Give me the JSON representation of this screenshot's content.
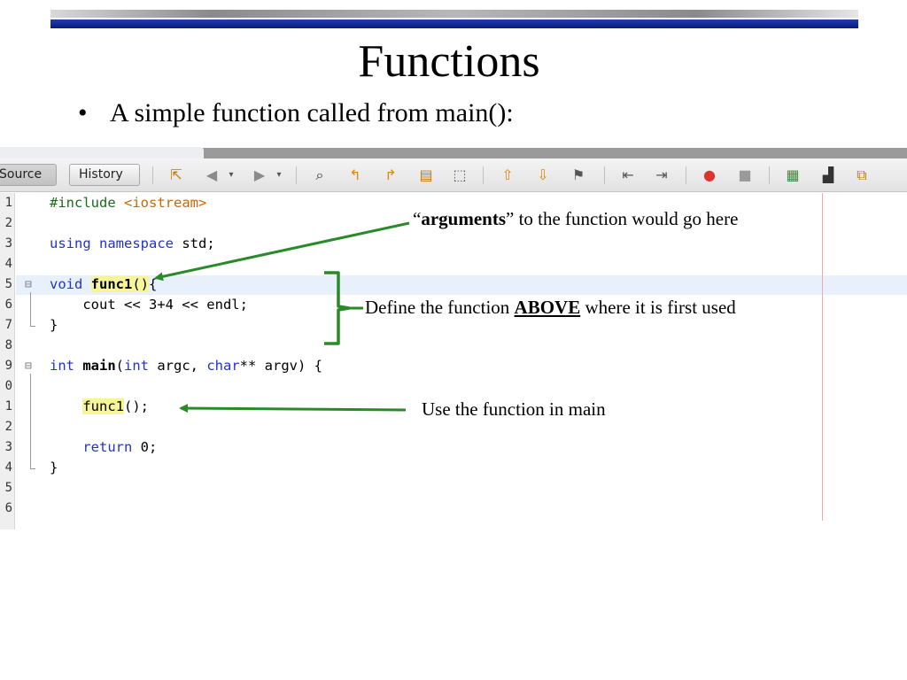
{
  "slide": {
    "title": "Functions",
    "bullet_symbol": "•",
    "bullet_text": "A simple function called from main():"
  },
  "toolbar": {
    "source_label": "Source",
    "history_label": "History",
    "icons": [
      "last-edit-icon",
      "back-icon",
      "forward-icon",
      "find-icon",
      "find-previous-icon",
      "find-next-icon",
      "toggle-highlight-icon",
      "toggle-rect-selection-icon",
      "previous-bookmark-icon",
      "next-bookmark-icon",
      "toggle-bookmark-icon",
      "shift-left-icon",
      "shift-right-icon",
      "start-macro-icon",
      "stop-macro-icon",
      "diff-icon",
      "format-icon",
      "debug-icon"
    ]
  },
  "editor": {
    "line_numbers": [
      "1",
      "2",
      "3",
      "4",
      "5",
      "6",
      "7",
      "8",
      "9",
      "0",
      "1",
      "2",
      "3",
      "4",
      "5",
      "6"
    ],
    "fold_markers": [
      "⊟",
      "⊟"
    ]
  },
  "code": {
    "l1_directive": "#include ",
    "l1_header": "<iostream>",
    "l3_using": "using",
    "l3_namespace": "namespace",
    "l3_rest": " std;",
    "l5_void": "void",
    "l5_name": "func1",
    "l5_parens": "()",
    "l5_brace": "{",
    "l6_body": "    cout << 3+4 << endl;",
    "l7_close": "}",
    "l9_int": "int",
    "l9_main": "main",
    "l9_open": "(",
    "l9_int2": "int",
    "l9_argc": " argc, ",
    "l9_char": "char",
    "l9_rest": "** argv) {",
    "l11_call": "func1",
    "l11_rest": "();",
    "l13_return": "return",
    "l13_rest": " 0;",
    "l14_close": "}"
  },
  "annotations": {
    "arguments_open_quote": "“",
    "arguments_word": "arguments",
    "arguments_rest": "” to the function would go here",
    "define_prefix": "Define the function ",
    "define_emphasis": "ABOVE",
    "define_suffix": " where it is first used",
    "use_text": "Use the function in main",
    "arrow_color": "#2a8a2a"
  }
}
